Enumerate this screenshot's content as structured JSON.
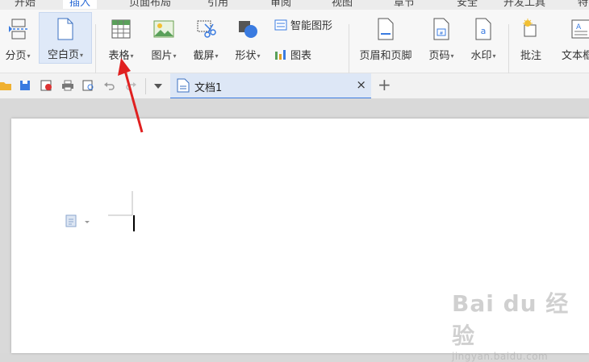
{
  "menu_tabs": [
    "开始",
    "插入",
    "页面布局",
    "引用",
    "审阅",
    "视图",
    "章节",
    "安全",
    "开发工具",
    "特"
  ],
  "ribbon": {
    "page_break": "分页",
    "blank_page": "空白页",
    "table": "表格",
    "picture": "图片",
    "screenshot": "截屏",
    "shape": "形状",
    "smart_shape": "智能图形",
    "chart": "图表",
    "header_footer": "页眉和页脚",
    "page_number": "页码",
    "watermark": "水印",
    "comment": "批注",
    "text_box": "文本框"
  },
  "document_tab": {
    "title": "文档1",
    "close": "×"
  },
  "new_tab": "+",
  "watermark": {
    "brand": "Bai du 经验",
    "url": "jingyan.baidu.com"
  },
  "colors": {
    "accent": "#2b6bd6",
    "arrow": "#e02020",
    "selected_bg": "#dfe9f8"
  }
}
